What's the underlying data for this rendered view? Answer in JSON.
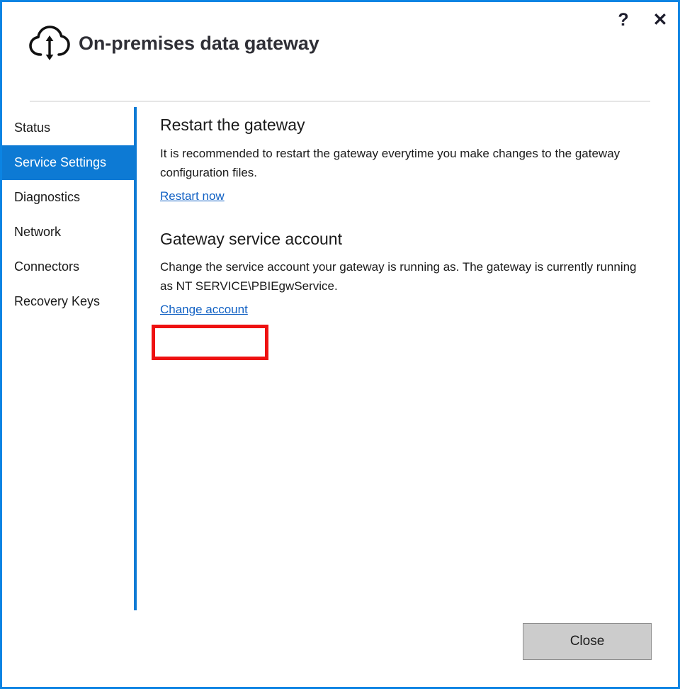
{
  "window": {
    "title": "On-premises data gateway",
    "accent_color": "#0d7ad4",
    "border_color": "#0b84e3",
    "help_icon": "question-mark-icon",
    "close_icon": "close-x-icon",
    "help_label": "?",
    "close_label": "✕",
    "brand_icon": "cloud-upload-download-icon"
  },
  "sidebar": {
    "items": [
      {
        "label": "Status",
        "selected": false
      },
      {
        "label": "Service Settings",
        "selected": true
      },
      {
        "label": "Diagnostics",
        "selected": false
      },
      {
        "label": "Network",
        "selected": false
      },
      {
        "label": "Connectors",
        "selected": false
      },
      {
        "label": "Recovery Keys",
        "selected": false
      }
    ]
  },
  "main": {
    "sections": [
      {
        "heading": "Restart the gateway",
        "body": "It is recommended to restart the gateway everytime you make changes to the gateway configuration files.",
        "link": "Restart now"
      },
      {
        "heading": "Gateway service account",
        "body": "Change the service account your gateway is running as. The gateway is currently running as NT SERVICE\\PBIEgwService.",
        "link": "Change account"
      }
    ]
  },
  "highlight": {
    "color": "#ee1111",
    "target": "Change account"
  },
  "footer": {
    "close_label": "Close"
  }
}
